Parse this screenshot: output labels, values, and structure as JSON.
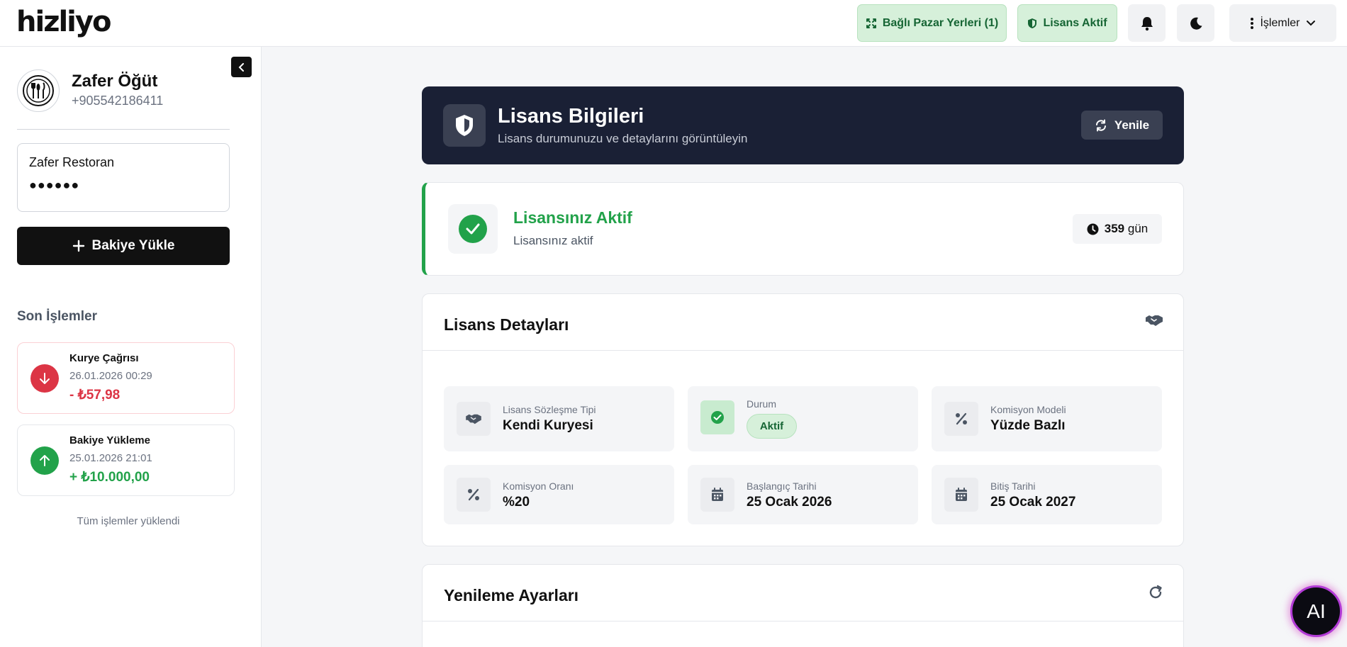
{
  "app": {
    "logo": "hizliyo"
  },
  "header": {
    "marketplaces_label": "Bağlı Pazar Yerleri (1)",
    "license_label": "Lisans Aktif",
    "actions_label": "İşlemler"
  },
  "sidebar": {
    "user_name": "Zafer Öğüt",
    "user_phone": "+905542186411",
    "restaurant_name": "Zafer Restoran",
    "restaurant_password": "●●●●●●",
    "load_balance_label": "Bakiye Yükle",
    "recent_title": "Son İşlemler",
    "transactions": [
      {
        "title": "Kurye Çağrısı",
        "date": "26.01.2026 00:29",
        "amount": "- ₺57,98",
        "type": "debit"
      },
      {
        "title": "Bakiye Yükleme",
        "date": "25.01.2026 21:01",
        "amount": "+ ₺10.000,00",
        "type": "credit"
      }
    ],
    "all_loaded": "Tüm işlemler yüklendi"
  },
  "license_header": {
    "title": "Lisans Bilgileri",
    "subtitle": "Lisans durumunuzu ve detaylarını görüntüleyin",
    "refresh_label": "Yenile"
  },
  "license_status": {
    "title": "Lisansınız Aktif",
    "subtitle": "Lisansınız aktif",
    "days_count": "359",
    "days_unit": "gün"
  },
  "license_details": {
    "title": "Lisans Detayları",
    "items": [
      {
        "label": "Lisans Sözleşme Tipi",
        "value": "Kendi Kuryesi",
        "icon": "handshake-icon"
      },
      {
        "label": "Durum",
        "value": "Aktif",
        "icon": "check-icon"
      },
      {
        "label": "Komisyon Modeli",
        "value": "Yüzde Bazlı",
        "icon": "percent-icon"
      },
      {
        "label": "Komisyon Oranı",
        "value": "%20",
        "icon": "percent-icon"
      },
      {
        "label": "Başlangıç Tarihi",
        "value": "25 Ocak 2026",
        "icon": "calendar-icon"
      },
      {
        "label": "Bitiş Tarihi",
        "value": "25 Ocak 2027",
        "icon": "calendar-icon"
      }
    ]
  },
  "renewal": {
    "title": "Yenileme Ayarları"
  },
  "ai_button": {
    "label": "AI"
  },
  "colors": {
    "accent_green": "#22a24a",
    "debit_red": "#dc3545",
    "hero_bg": "#1a2035"
  }
}
